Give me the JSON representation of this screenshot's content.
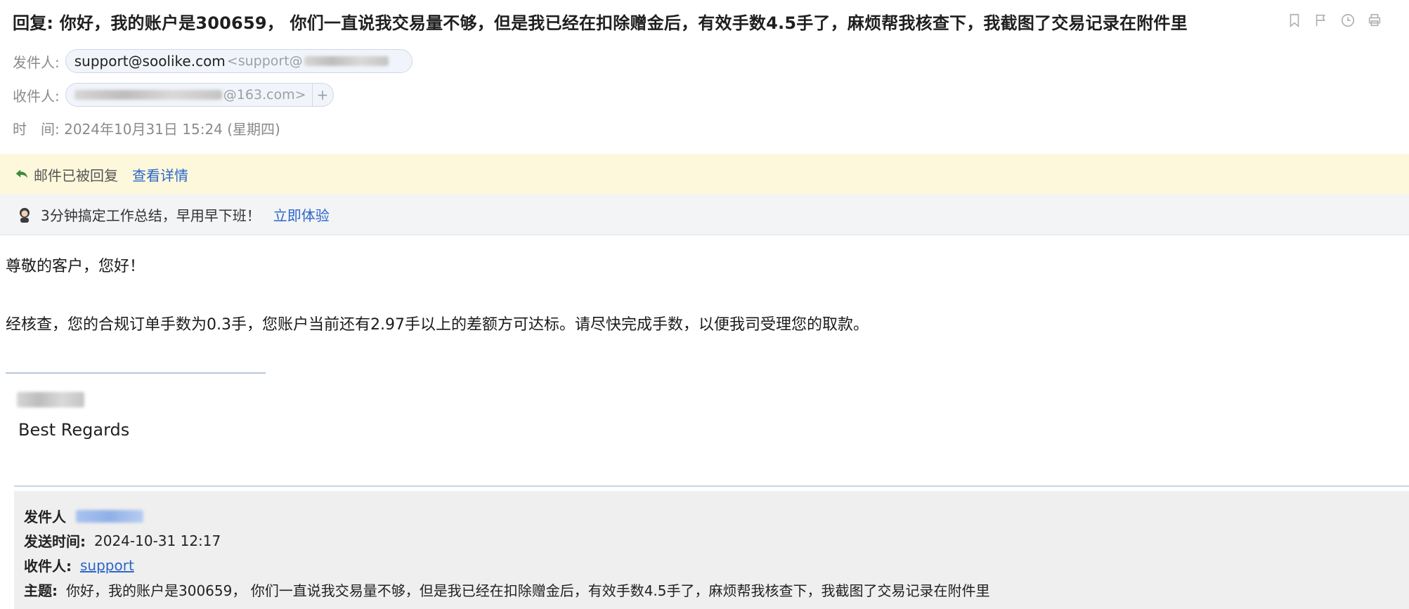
{
  "header": {
    "subject": "回复: 你好，我的账户是300659， 你们一直说我交易量不够，但是我已经在扣除赠金后，有效手数4.5手了，麻烦帮我核查下，我截图了交易记录在附件里",
    "from_label": "发件人:",
    "from_name": "support@soolike.com",
    "from_addr": "<support@",
    "to_label": "收件人:",
    "to_addr": "@163.com>",
    "to_plus": "+",
    "time_label": "时　间:",
    "time_value": "2024年10月31日 15:24 (星期四)",
    "toolbar_icons": [
      "bookmark-icon",
      "flag-icon",
      "clock-icon",
      "print-icon"
    ]
  },
  "banner": {
    "replied_text": "邮件已被回复",
    "details_link": "查看详情"
  },
  "promo": {
    "text": "3分钟搞定工作总结，早用早下班！",
    "link": "立即体验"
  },
  "body": {
    "greeting": "尊敬的客户，您好！",
    "paragraph": "经核查，您的合规订单手数为0.3手，您账户当前还有2.97手以上的差额方可达标。请尽快完成手数，以便我司受理您的取款。",
    "regards": "Best Regards"
  },
  "quote": {
    "from_label": "发件人",
    "sent_label": "发送时间:",
    "sent_value": "2024-10-31 12:17",
    "to_label": "收件人:",
    "to_value": "support",
    "subject_label": "主题:",
    "subject_value": "你好，我的账户是300659， 你们一直说我交易量不够，但是我已经在扣除赠金后，有效手数4.5手了，麻烦帮我核查下，我截图了交易记录在附件里"
  },
  "colors": {
    "link": "#2b66c9",
    "banner_bg": "#fdf8dc",
    "promo_bg": "#f3f4f6",
    "quote_bg": "#efefef",
    "reply_icon": "#3a8a3a"
  }
}
